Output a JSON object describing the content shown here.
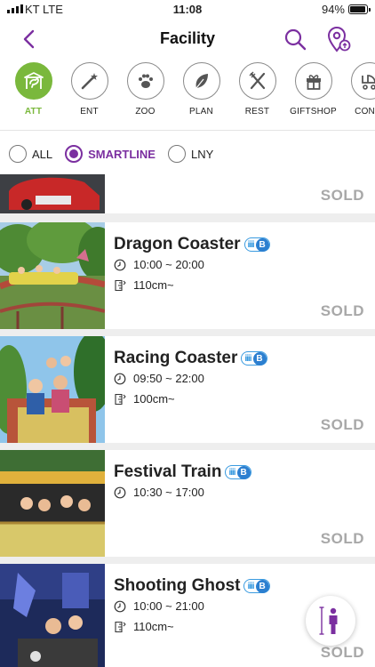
{
  "status_bar": {
    "carrier": "KT  LTE",
    "time": "11:08",
    "battery": "94%"
  },
  "header": {
    "title": "Facility"
  },
  "categories": [
    {
      "label": "ATT",
      "icon": "carousel-horse-icon",
      "active": true
    },
    {
      "label": "ENT",
      "icon": "magic-wand-icon",
      "active": false
    },
    {
      "label": "ZOO",
      "icon": "paw-icon",
      "active": false
    },
    {
      "label": "PLAN",
      "icon": "leaf-icon",
      "active": false
    },
    {
      "label": "REST",
      "icon": "fork-knife-icon",
      "active": false
    },
    {
      "label": "GIFTSHOP",
      "icon": "gift-icon",
      "active": false
    },
    {
      "label": "CONVI",
      "icon": "stroller-icon",
      "active": false
    }
  ],
  "filters": [
    {
      "label": "ALL",
      "checked": false
    },
    {
      "label": "SMARTLINE",
      "checked": true
    },
    {
      "label": "LNY",
      "checked": false
    }
  ],
  "items": [
    {
      "name": "",
      "hours": "",
      "height": "",
      "status": "SOLD"
    },
    {
      "name": "Dragon Coaster",
      "hours": "10:00 ~ 20:00",
      "height": "110cm~",
      "status": "SOLD"
    },
    {
      "name": "Racing Coaster",
      "hours": "09:50 ~ 22:00",
      "height": "100cm~",
      "status": "SOLD"
    },
    {
      "name": "Festival Train",
      "hours": "10:30 ~ 17:00",
      "height": "",
      "status": "SOLD"
    },
    {
      "name": "Shooting Ghost",
      "hours": "10:00 ~ 21:00",
      "height": "110cm~",
      "status": "SOLD"
    }
  ],
  "badge_letter": "B",
  "colors": {
    "accent_purple": "#7b2fa0",
    "active_green": "#7ab83c",
    "badge_blue": "#2c7fd0",
    "sold_gray": "#a8a8a8"
  }
}
